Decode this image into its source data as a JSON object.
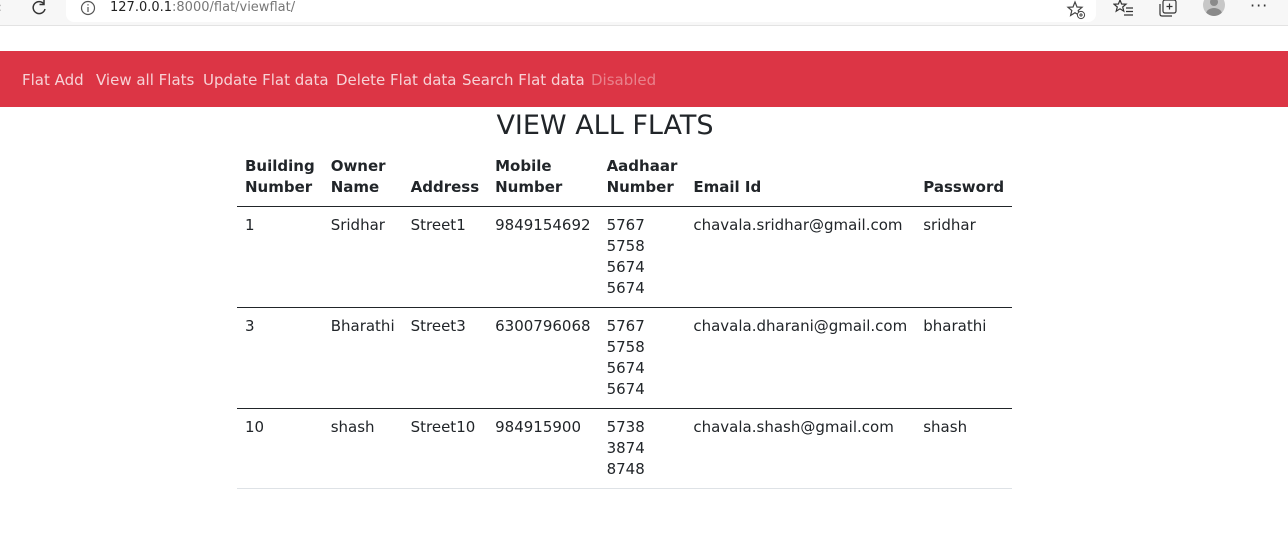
{
  "browser": {
    "url_host": "127.0.0.1",
    "url_rest": ":8000/flat/viewflat/"
  },
  "navbar": {
    "links": [
      {
        "label": "Flat Add"
      },
      {
        "label": "View all Flats"
      },
      {
        "label": "Update Flat data"
      },
      {
        "label": "Delete Flat data"
      },
      {
        "label": "Search Flat data"
      },
      {
        "label": "Disabled"
      }
    ],
    "color": "#dc3545"
  },
  "page": {
    "title": "VIEW ALL FLATS"
  },
  "table": {
    "headers": [
      "Building Number",
      "Owner Name",
      "Address",
      "Mobile Number",
      "Aadhaar Number",
      "Email Id",
      "Password"
    ],
    "rows": [
      {
        "building": "1",
        "owner": "Sridhar",
        "address": "Street1",
        "mobile": "9849154692",
        "aadhaar": "5767 5758 5674 5674",
        "email": "chavala.sridhar@gmail.com",
        "password": "sridhar"
      },
      {
        "building": "3",
        "owner": "Bharathi",
        "address": "Street3",
        "mobile": "6300796068",
        "aadhaar": "5767 5758 5674 5674",
        "email": "chavala.dharani@gmail.com",
        "password": "bharathi"
      },
      {
        "building": "10",
        "owner": "shash",
        "address": "Street10",
        "mobile": "984915900",
        "aadhaar": "5738 3874 8748",
        "email": "chavala.shash@gmail.com",
        "password": "shash"
      }
    ]
  }
}
